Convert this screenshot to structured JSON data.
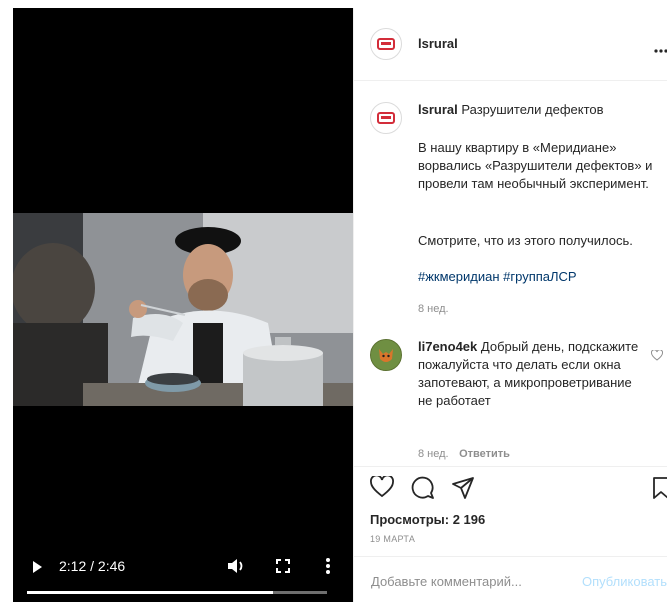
{
  "post": {
    "username": "lsrural",
    "caption_title": "Разрушители дефектов",
    "caption_paragraph1": "В нашу квартиру в «Меридиане» ворвались «Разрушители дефектов» и провели там необычный эксперимент.",
    "caption_paragraph2": "Смотрите, что из этого получилось.",
    "hashtags": "#жкмеридиан #группаЛСР",
    "caption_time": "8 нед."
  },
  "comment": {
    "username": "li7eno4ek",
    "text": "Добрый день, подскажите пожалуйста что делать если окна запотевают, а микропроветривание не работает",
    "time": "8 нед.",
    "reply_label": "Ответить"
  },
  "stats": {
    "views": "Просмотры: 2 196",
    "date": "19 МАРТА"
  },
  "comment_box": {
    "placeholder": "Добавьте комментарий...",
    "post_label": "Опубликовать"
  },
  "video": {
    "time": "2:12 / 2:46",
    "progress": 0.82
  },
  "colors": {
    "brand_red": "#d32d3a",
    "link_blue": "#00376b",
    "muted": "#8e8e8e",
    "disabled_blue": "#b2dffc"
  }
}
